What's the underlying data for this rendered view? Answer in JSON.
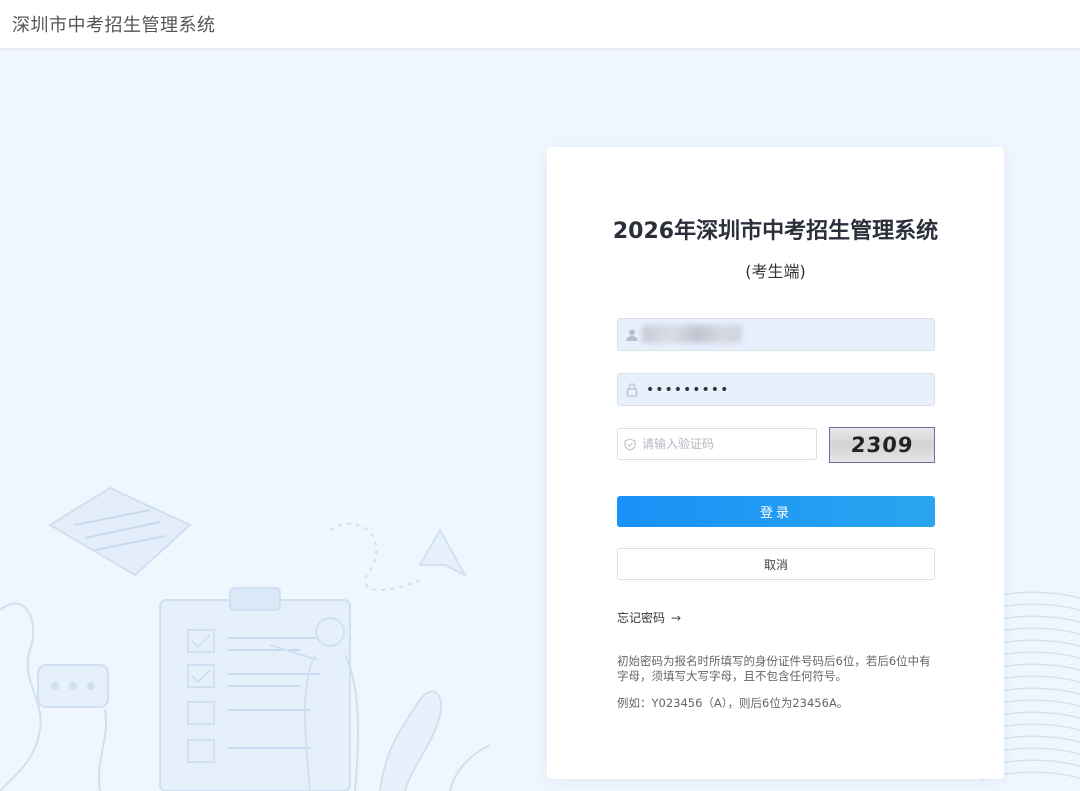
{
  "header": {
    "title": "深圳市中考招生管理系统"
  },
  "login": {
    "title": "2026年深圳市中考招生管理系统",
    "subtitle": "(考生端)",
    "username_value": "",
    "password_value": "•••••••••",
    "captcha_placeholder": "请输入验证码",
    "captcha_code": "2309",
    "login_label": "登录",
    "cancel_label": "取消",
    "forgot_label": "忘记密码",
    "forgot_arrow": "→",
    "note_initial_password": "初始密码为报名时所填写的身份证件号码后6位，若后6位中有字母，须填写大写字母，且不包含任何符号。",
    "note_example": "例如：Y023456（A），则后6位为23456A。"
  },
  "icons": {
    "username": "user-icon",
    "password": "lock-icon",
    "captcha": "shield-icon"
  },
  "colors": {
    "accent": "#1891f8",
    "page_background": "#f0f6fd",
    "autofill_background": "#e8f0fe"
  }
}
